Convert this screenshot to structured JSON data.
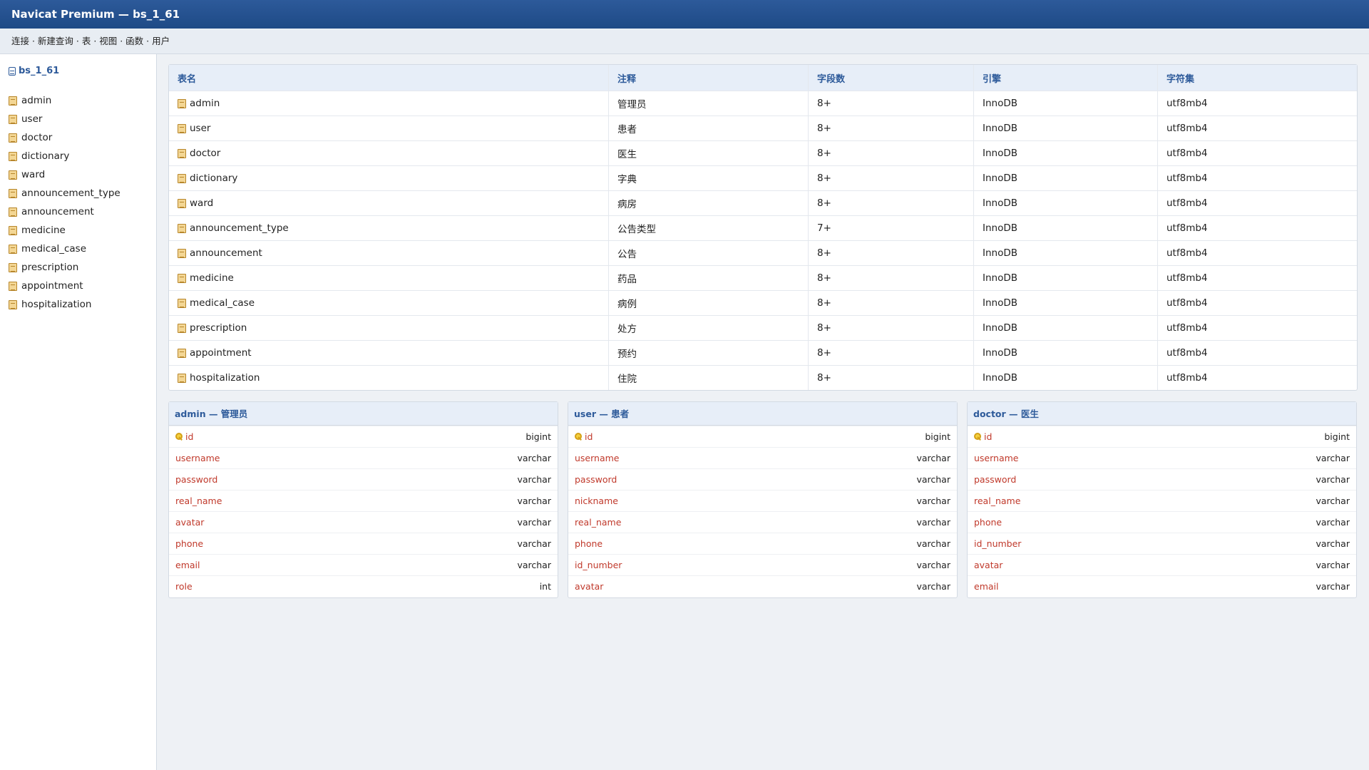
{
  "window": {
    "title": "Navicat Premium — bs_1_61"
  },
  "menu": {
    "text": "连接 · 新建查询 · 表 · 视图 · 函数 · 用户"
  },
  "sidebar": {
    "database": "bs_1_61",
    "items": [
      "admin",
      "user",
      "doctor",
      "dictionary",
      "ward",
      "announcement_type",
      "announcement",
      "medicine",
      "medical_case",
      "prescription",
      "appointment",
      "hospitalization"
    ]
  },
  "table": {
    "headers": [
      "表名",
      "注释",
      "字段数",
      "引擎",
      "字符集"
    ],
    "rows": [
      [
        "admin",
        "管理员",
        "8+",
        "InnoDB",
        "utf8mb4"
      ],
      [
        "user",
        "患者",
        "8+",
        "InnoDB",
        "utf8mb4"
      ],
      [
        "doctor",
        "医生",
        "8+",
        "InnoDB",
        "utf8mb4"
      ],
      [
        "dictionary",
        "字典",
        "8+",
        "InnoDB",
        "utf8mb4"
      ],
      [
        "ward",
        "病房",
        "8+",
        "InnoDB",
        "utf8mb4"
      ],
      [
        "announcement_type",
        "公告类型",
        "7+",
        "InnoDB",
        "utf8mb4"
      ],
      [
        "announcement",
        "公告",
        "8+",
        "InnoDB",
        "utf8mb4"
      ],
      [
        "medicine",
        "药品",
        "8+",
        "InnoDB",
        "utf8mb4"
      ],
      [
        "medical_case",
        "病例",
        "8+",
        "InnoDB",
        "utf8mb4"
      ],
      [
        "prescription",
        "处方",
        "8+",
        "InnoDB",
        "utf8mb4"
      ],
      [
        "appointment",
        "预约",
        "8+",
        "InnoDB",
        "utf8mb4"
      ],
      [
        "hospitalization",
        "住院",
        "8+",
        "InnoDB",
        "utf8mb4"
      ]
    ]
  },
  "cards": [
    {
      "title": "admin — 管理员",
      "fields": [
        {
          "name": "id",
          "type": "bigint",
          "key": true
        },
        {
          "name": "username",
          "type": "varchar"
        },
        {
          "name": "password",
          "type": "varchar"
        },
        {
          "name": "real_name",
          "type": "varchar"
        },
        {
          "name": "avatar",
          "type": "varchar"
        },
        {
          "name": "phone",
          "type": "varchar"
        },
        {
          "name": "email",
          "type": "varchar"
        },
        {
          "name": "role",
          "type": "int"
        }
      ]
    },
    {
      "title": "user — 患者",
      "fields": [
        {
          "name": "id",
          "type": "bigint",
          "key": true
        },
        {
          "name": "username",
          "type": "varchar"
        },
        {
          "name": "password",
          "type": "varchar"
        },
        {
          "name": "nickname",
          "type": "varchar"
        },
        {
          "name": "real_name",
          "type": "varchar"
        },
        {
          "name": "phone",
          "type": "varchar"
        },
        {
          "name": "id_number",
          "type": "varchar"
        },
        {
          "name": "avatar",
          "type": "varchar"
        }
      ]
    },
    {
      "title": "doctor — 医生",
      "fields": [
        {
          "name": "id",
          "type": "bigint",
          "key": true
        },
        {
          "name": "username",
          "type": "varchar"
        },
        {
          "name": "password",
          "type": "varchar"
        },
        {
          "name": "real_name",
          "type": "varchar"
        },
        {
          "name": "phone",
          "type": "varchar"
        },
        {
          "name": "id_number",
          "type": "varchar"
        },
        {
          "name": "avatar",
          "type": "varchar"
        },
        {
          "name": "email",
          "type": "varchar"
        }
      ]
    }
  ],
  "colors": {
    "titlebar": "#2d5a9a",
    "accent": "#2d5a9a",
    "field_name": "#c0392b"
  }
}
